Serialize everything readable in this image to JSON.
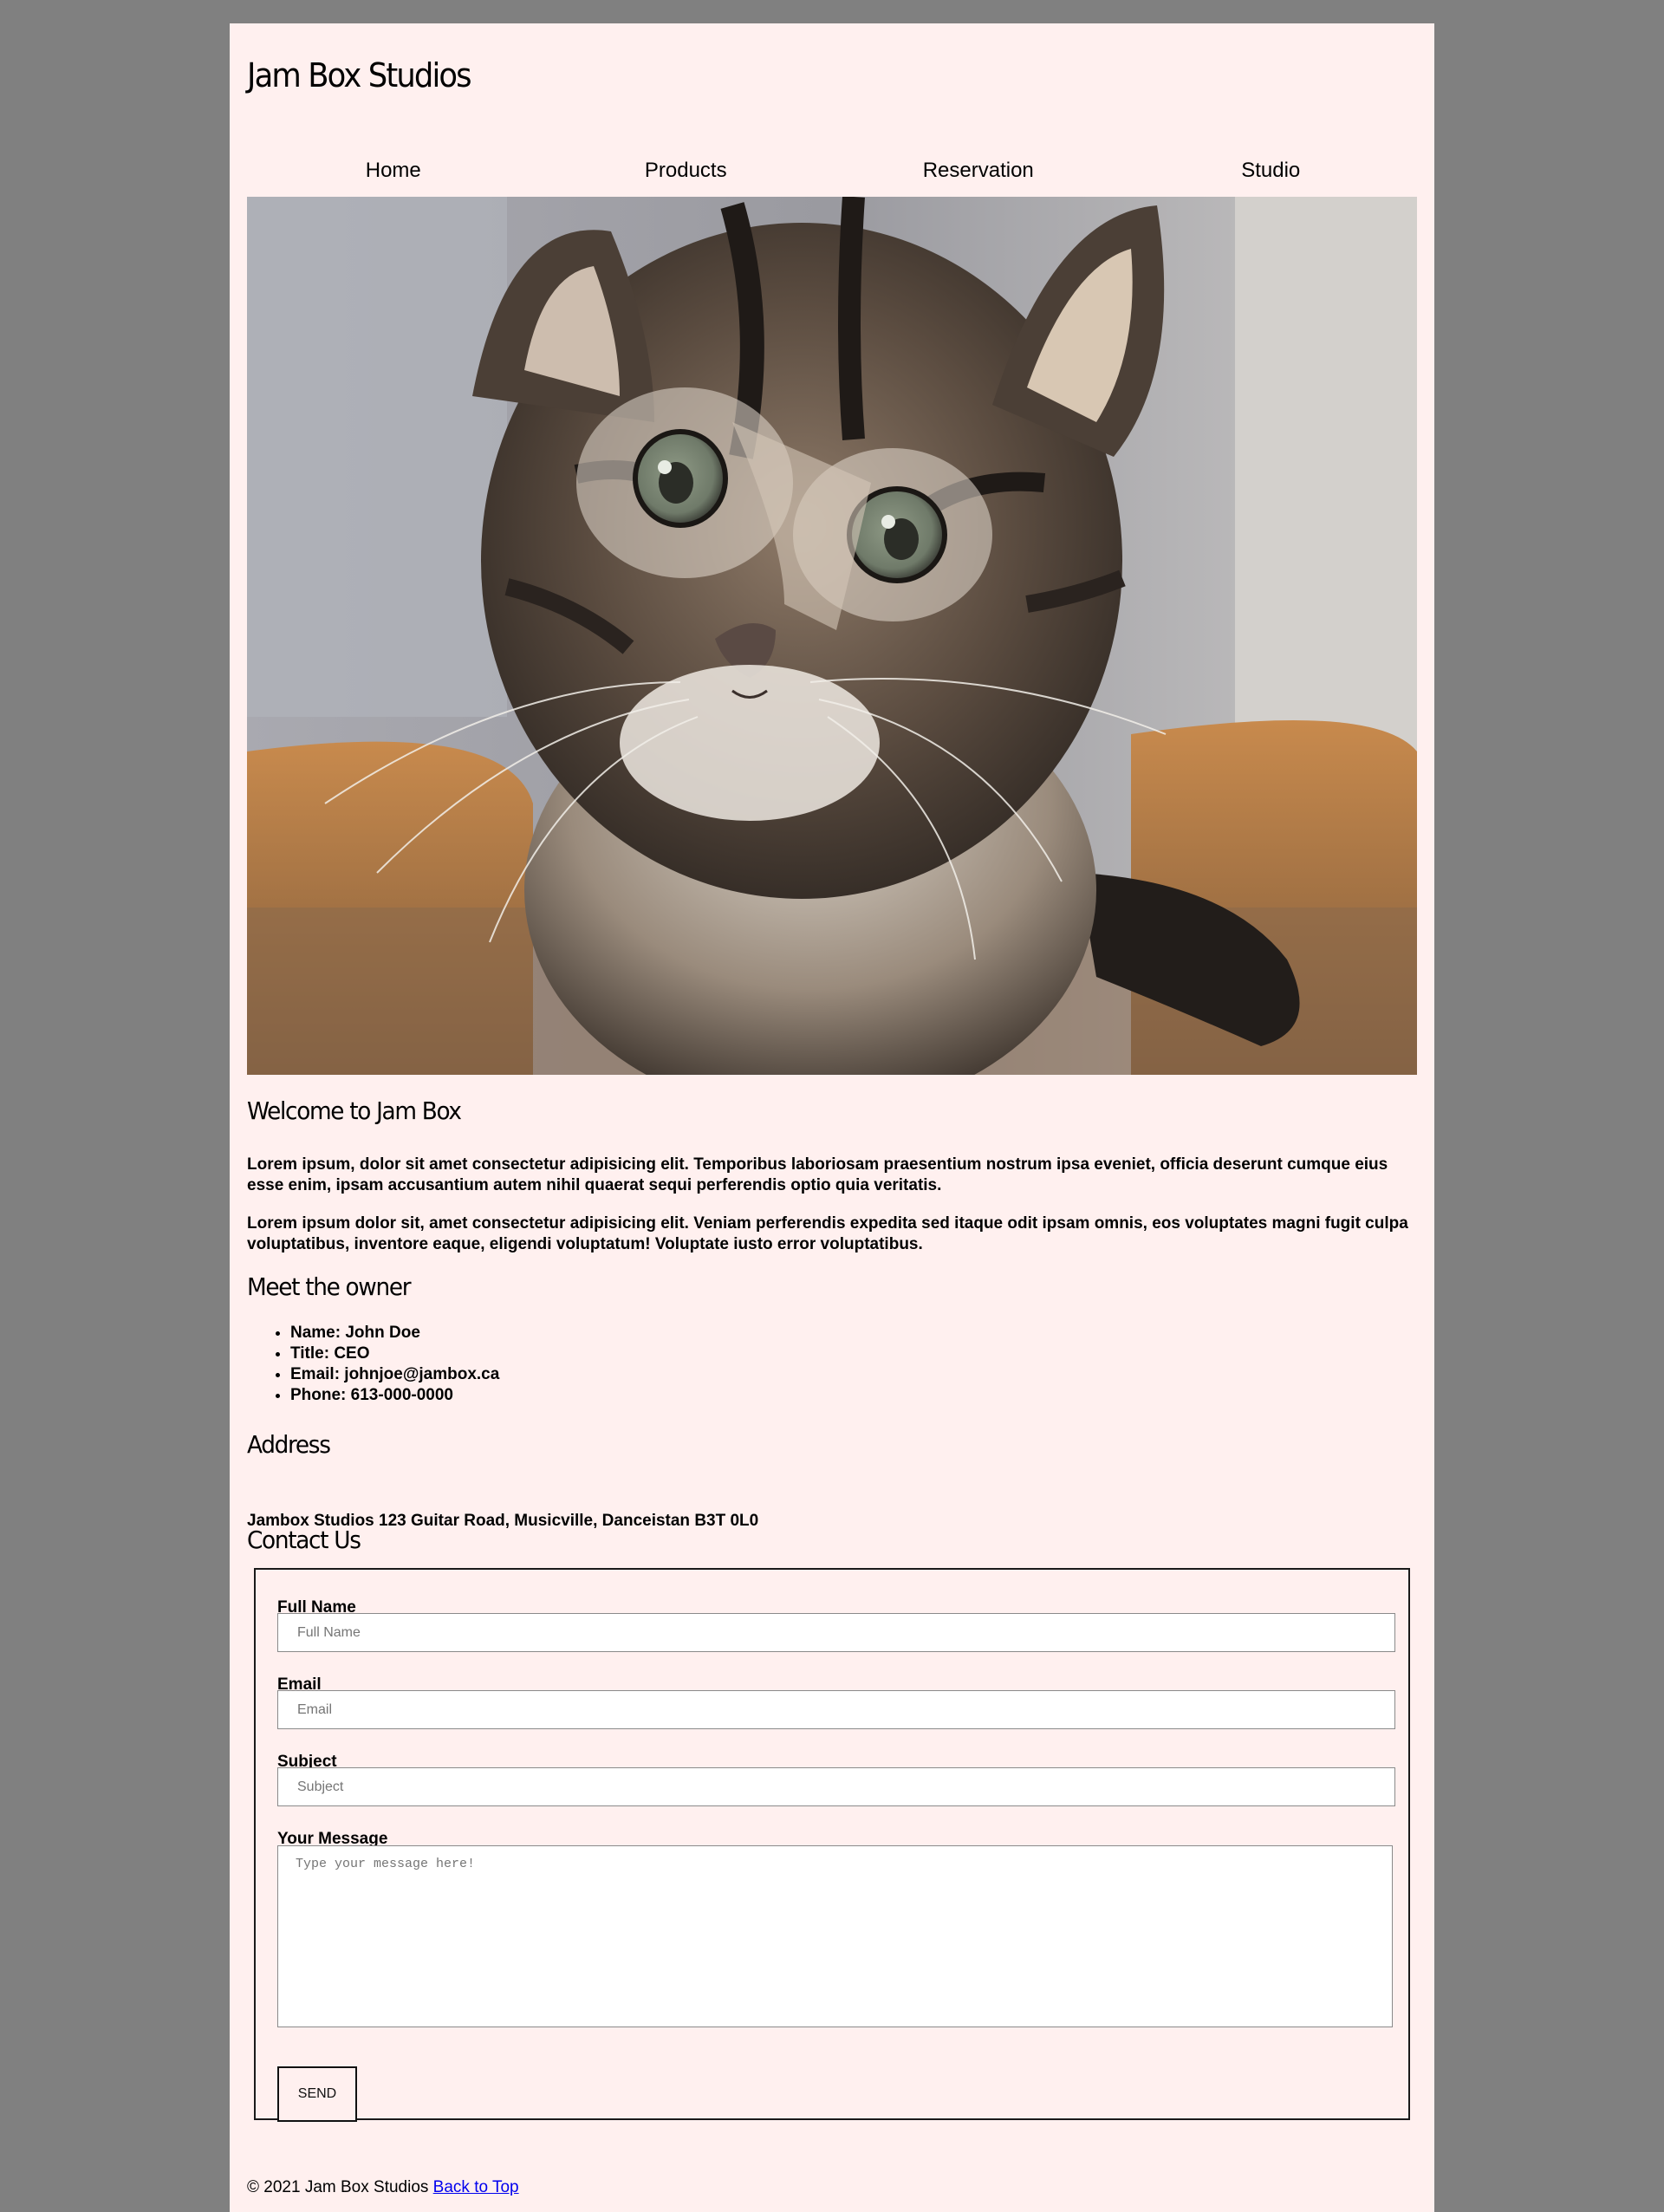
{
  "site": {
    "title": "Jam Box Studios"
  },
  "nav": {
    "items": [
      "Home",
      "Products",
      "Reservation",
      "Studio"
    ]
  },
  "hero": {
    "image_alt": "kitten photo"
  },
  "welcome": {
    "heading": "Welcome to Jam Box",
    "paragraph_1": "Lorem ipsum, dolor sit amet consectetur adipisicing elit. Temporibus laboriosam praesentium nostrum ipsa eveniet, officia deserunt cumque eius esse enim, ipsam accusantium autem nihil quaerat sequi perferendis optio quia veritatis.",
    "paragraph_2": "Lorem ipsum dolor sit, amet consectetur adipisicing elit. Veniam perferendis expedita sed itaque odit ipsam omnis, eos voluptates magni fugit culpa voluptatibus, inventore eaque, eligendi voluptatum! Voluptate iusto error voluptatibus."
  },
  "owner": {
    "heading": "Meet the owner",
    "items": [
      "Name: John Doe",
      "Title: CEO",
      "Email: johnjoe@jambox.ca",
      "Phone: 613-000-0000"
    ]
  },
  "address": {
    "heading": "Address",
    "text": "Jambox Studios 123 Guitar Road, Musicville, Danceistan B3T 0L0"
  },
  "contact": {
    "heading": "Contact Us",
    "full_name_label": "Full Name",
    "full_name_placeholder": "Full Name",
    "email_label": "Email",
    "email_placeholder": "Email",
    "subject_label": "Subject",
    "subject_placeholder": "Subject",
    "message_label": "Your Message",
    "message_placeholder": "Type your message here!",
    "send_label": "SEND"
  },
  "footer": {
    "copyright": "© 2021 Jam Box Studios",
    "back_to_top": "Back to Top"
  },
  "colors": {
    "page_background": "#808080",
    "content_background": "#fff0ef",
    "link": "#0000ee"
  }
}
